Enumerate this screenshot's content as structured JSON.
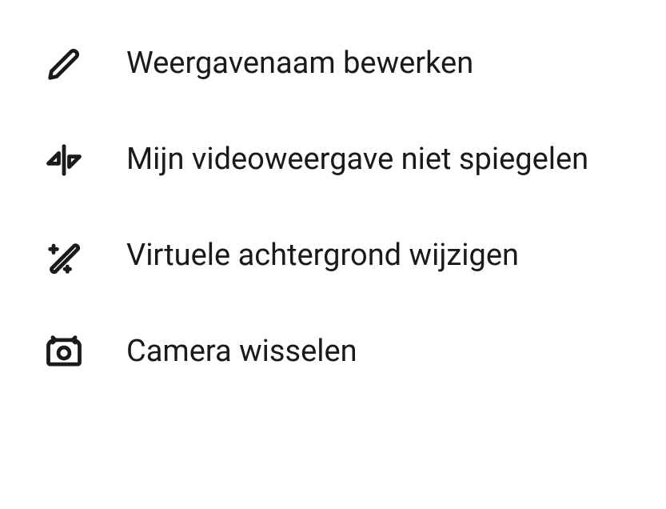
{
  "menu": {
    "items": [
      {
        "label": "Weergavenaam bewerken"
      },
      {
        "label": "Mijn videoweergave niet spiegelen"
      },
      {
        "label": "Virtuele achtergrond wijzigen"
      },
      {
        "label": "Camera wisselen"
      }
    ]
  }
}
